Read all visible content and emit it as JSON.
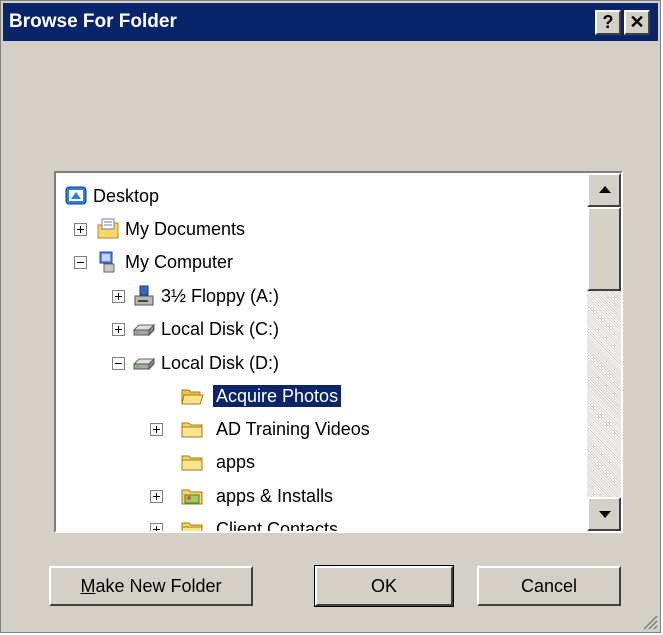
{
  "window": {
    "title": "Browse For Folder",
    "help_label": "?",
    "close_label": "✕"
  },
  "tree": {
    "items": [
      {
        "label": "Desktop",
        "icon": "desktop-icon"
      },
      {
        "label": "My Documents",
        "icon": "my-documents-icon",
        "expander": "plus"
      },
      {
        "label": "My Computer",
        "icon": "my-computer-icon",
        "expander": "minus"
      },
      {
        "label": "3½ Floppy (A:)",
        "icon": "floppy-drive-icon",
        "expander": "plus"
      },
      {
        "label": "Local Disk (C:)",
        "icon": "hard-drive-icon",
        "expander": "plus"
      },
      {
        "label": "Local Disk (D:)",
        "icon": "hard-drive-icon",
        "expander": "minus"
      },
      {
        "label": "Acquire Photos",
        "icon": "open-folder-icon",
        "selected": true
      },
      {
        "label": "AD Training Videos",
        "icon": "folder-icon",
        "expander": "plus"
      },
      {
        "label": "apps",
        "icon": "folder-icon"
      },
      {
        "label": "apps & Installs",
        "icon": "photo-folder-icon",
        "expander": "plus"
      },
      {
        "label": "Client Contacts",
        "icon": "folder-icon",
        "expander": "plus"
      }
    ]
  },
  "buttons": {
    "make_new_folder_mnemonic": "M",
    "make_new_folder_rest": "ake New Folder",
    "ok": "OK",
    "cancel": "Cancel"
  },
  "colors": {
    "titlebar": "#0a246a",
    "face": "#d4d0c8",
    "selection": "#0a246a"
  }
}
